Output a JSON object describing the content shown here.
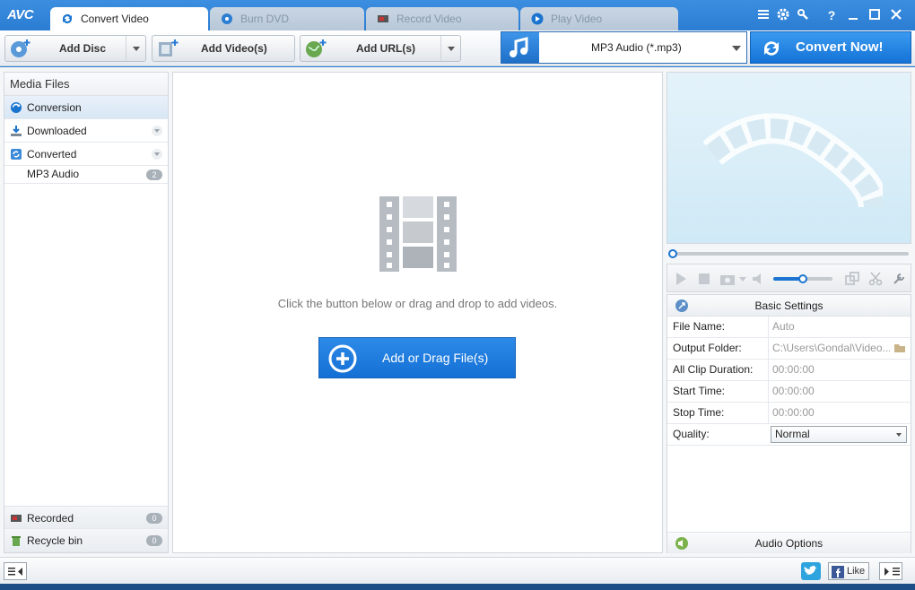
{
  "app": {
    "logo": "AVC"
  },
  "tabs": [
    {
      "label": "Convert Video",
      "active": true,
      "icon": "convert-icon"
    },
    {
      "label": "Burn DVD",
      "active": false,
      "icon": "disc-icon"
    },
    {
      "label": "Record Video",
      "active": false,
      "icon": "record-icon"
    },
    {
      "label": "Play Video",
      "active": false,
      "icon": "play-icon"
    }
  ],
  "toolbar": {
    "add_disc": "Add Disc",
    "add_videos": "Add Video(s)",
    "add_url": "Add URL(s)",
    "format": "MP3 Audio (*.mp3)",
    "convert_now": "Convert Now!"
  },
  "sidebar": {
    "header": "Media Files",
    "items": [
      {
        "label": "Conversion",
        "icon": "convert-icon"
      },
      {
        "label": "Downloaded",
        "icon": "download-icon"
      },
      {
        "label": "Converted",
        "icon": "converted-icon"
      },
      {
        "label": "MP3 Audio",
        "count": "2"
      }
    ],
    "bottom": [
      {
        "label": "Recorded",
        "count": "0",
        "icon": "record-icon"
      },
      {
        "label": "Recycle bin",
        "count": "0",
        "icon": "trash-icon"
      }
    ]
  },
  "center": {
    "hint": "Click the button below or drag and drop to add videos.",
    "add_button": "Add or Drag File(s)"
  },
  "settings": {
    "header": "Basic Settings",
    "rows": [
      {
        "key": "File Name:",
        "value": "Auto"
      },
      {
        "key": "Output Folder:",
        "value": "C:\\Users\\Gondal\\Video..."
      },
      {
        "key": "All Clip Duration:",
        "value": "00:00:00"
      },
      {
        "key": "Start Time:",
        "value": "00:00:00"
      },
      {
        "key": "Stop Time:",
        "value": "00:00:00"
      },
      {
        "key": "Quality:",
        "value": "Normal"
      }
    ],
    "audio_options": "Audio Options"
  },
  "status": {
    "like": "Like"
  },
  "colors": {
    "accent": "#2b7dd3",
    "button": "#1470d4"
  }
}
